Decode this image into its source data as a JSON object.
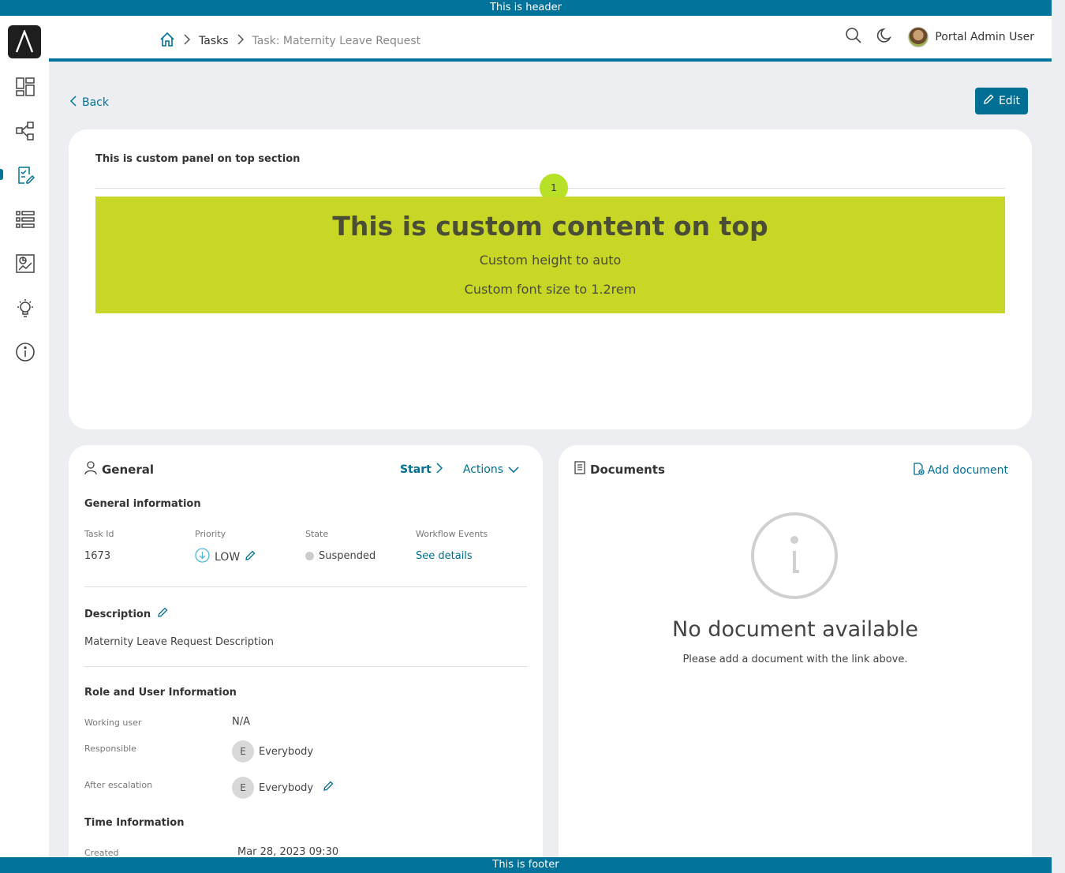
{
  "banners": {
    "header": "This is header",
    "footer": "This is footer"
  },
  "breadcrumb": {
    "home_icon": "home-icon",
    "tasks": "Tasks",
    "current": "Task: Maternity Leave Request"
  },
  "topbar": {
    "user_name": "Portal Admin User"
  },
  "sidebar": {
    "items": [
      "dashboard-icon",
      "process-icon",
      "task-icon",
      "case-list-icon",
      "statistics-icon",
      "idea-icon",
      "info-icon"
    ]
  },
  "page": {
    "back_label": "Back",
    "edit_label": "Edit"
  },
  "custom_panel": {
    "title": "This is custom panel on top section",
    "step": "1",
    "heading": "This is custom content on top",
    "line1": "Custom height to auto",
    "line2": "Custom font size to 1.2rem"
  },
  "general": {
    "title": "General",
    "start_label": "Start",
    "actions_label": "Actions",
    "info_title": "General information",
    "task_id_label": "Task Id",
    "task_id": "1673",
    "priority_label": "Priority",
    "priority": "LOW",
    "state_label": "State",
    "state": "Suspended",
    "workflow_label": "Workflow Events",
    "workflow_link": "See details",
    "description_title": "Description",
    "description": "Maternity Leave Request Description",
    "role_title": "Role and User Information",
    "working_user_label": "Working user",
    "working_user": "N/A",
    "responsible_label": "Responsible",
    "responsible_initial": "E",
    "responsible": "Everybody",
    "escalation_label": "After escalation",
    "escalation_initial": "E",
    "escalation": "Everybody",
    "time_title": "Time Information",
    "created_label": "Created",
    "created": "Mar 28, 2023 09:30"
  },
  "documents": {
    "title": "Documents",
    "add_label": "Add document",
    "empty_title": "No document available",
    "empty_sub": "Please add a document with the link above."
  }
}
